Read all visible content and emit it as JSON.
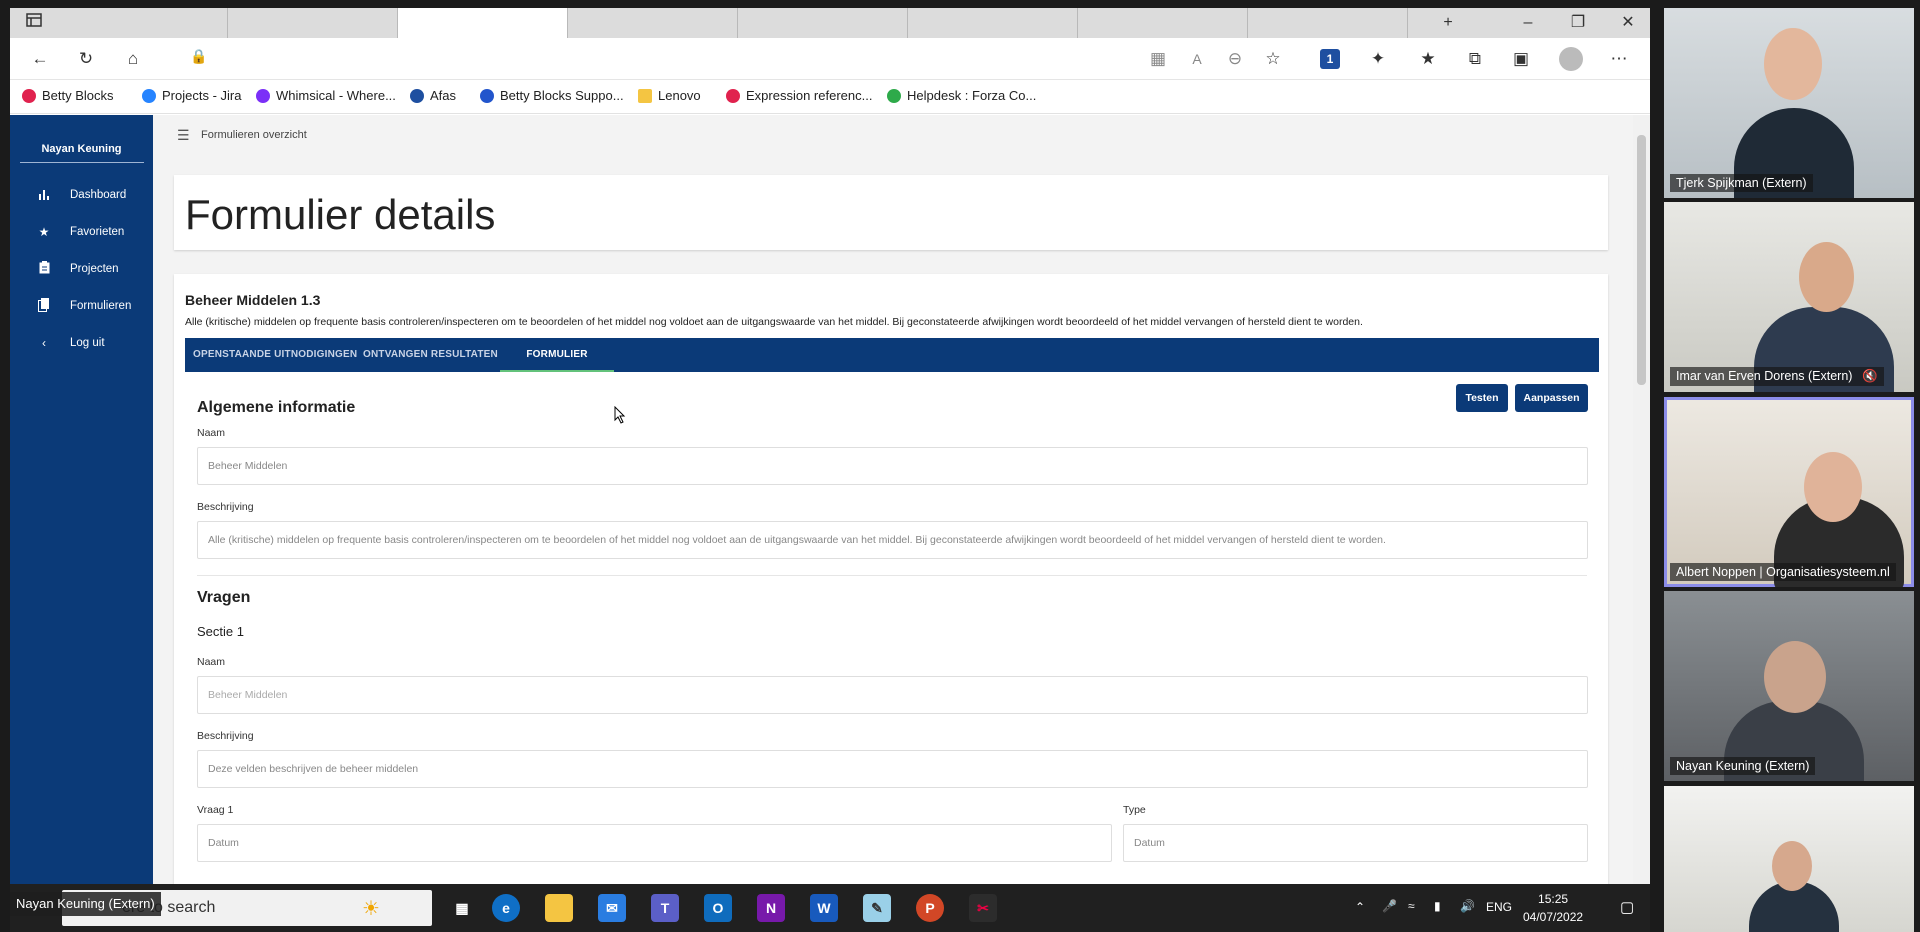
{
  "browser": {
    "bookmarks": [
      {
        "label": "Betty Blocks",
        "icon": "betty-blocks-icon",
        "color": "#e0224e"
      },
      {
        "label": "Projects - Jira",
        "icon": "jira-icon",
        "color": "#2684ff"
      },
      {
        "label": "Whimsical - Where...",
        "icon": "whimsical-icon",
        "color": "#7b2ff7"
      },
      {
        "label": "Afas",
        "icon": "afas-icon",
        "color": "#1e4fa0"
      },
      {
        "label": "Betty Blocks Suppo...",
        "icon": "betty-blocks-support-icon",
        "color": "#2255cc"
      },
      {
        "label": "Lenovo",
        "icon": "folder-icon",
        "color": "#f4c542"
      },
      {
        "label": "Expression referenc...",
        "icon": "expression-icon",
        "color": "#e0224e"
      },
      {
        "label": "Helpdesk : Forza Co...",
        "icon": "helpdesk-icon",
        "color": "#2eaa4a"
      }
    ]
  },
  "sidebar": {
    "user": "Nayan Keuning",
    "items": [
      {
        "label": "Dashboard",
        "icon": "bar-chart-icon"
      },
      {
        "label": "Favorieten",
        "icon": "star-icon"
      },
      {
        "label": "Projecten",
        "icon": "clipboard-icon"
      },
      {
        "label": "Formulieren",
        "icon": "document-icon"
      },
      {
        "label": "Log uit",
        "icon": "chevron-left-icon"
      }
    ]
  },
  "breadcrumb": "Formulieren overzicht",
  "page_title": "Formulier details",
  "form": {
    "title": "Beheer Middelen 1.3",
    "description": "Alle (kritische) middelen op frequente basis controleren/inspecteren om te beoordelen of het middel nog voldoet aan de uitgangswaarde van het middel. Bij geconstateerde afwijkingen wordt beoordeeld of het middel vervangen of hersteld dient te worden.",
    "tabs": [
      "OPENSTAANDE UITNODIGINGEN",
      "ONTVANGEN RESULTATEN",
      "FORMULIER"
    ],
    "active_tab": "FORMULIER",
    "general": {
      "heading": "Algemene informatie",
      "test_button": "Testen",
      "edit_button": "Aanpassen",
      "name_label": "Naam",
      "name_value": "Beheer Middelen",
      "desc_label": "Beschrijving",
      "desc_value": "Alle (kritische) middelen op frequente basis controleren/inspecteren om te beoordelen of het middel nog voldoet aan de uitgangswaarde van het middel. Bij geconstateerde afwijkingen wordt beoordeeld of het middel vervangen of hersteld dient te worden."
    },
    "questions": {
      "heading": "Vragen",
      "section_title": "Sectie 1",
      "name_label": "Naam",
      "name_value": "Beheer Middelen",
      "desc_label": "Beschrijving",
      "desc_value": "Deze velden beschrijven de beheer middelen",
      "q1_label": "Vraag 1",
      "q1_value": "Datum",
      "type_label": "Type",
      "type_value": "Datum"
    }
  },
  "taskbar": {
    "search_placeholder": "ere to search",
    "presenter": "Nayan Keuning (Extern)",
    "language": "ENG",
    "time": "15:25",
    "date": "04/07/2022"
  },
  "participants": [
    {
      "name": "Tjerk Spijkman (Extern)",
      "speaking": false
    },
    {
      "name": "Imar van Erven Dorens (Extern)",
      "speaking": false,
      "muted": true
    },
    {
      "name": "Albert Noppen | Organisatiesysteem.nl",
      "speaking": true
    },
    {
      "name": "Nayan Keuning (Extern)",
      "speaking": false
    },
    {
      "name": "",
      "speaking": false
    }
  ]
}
